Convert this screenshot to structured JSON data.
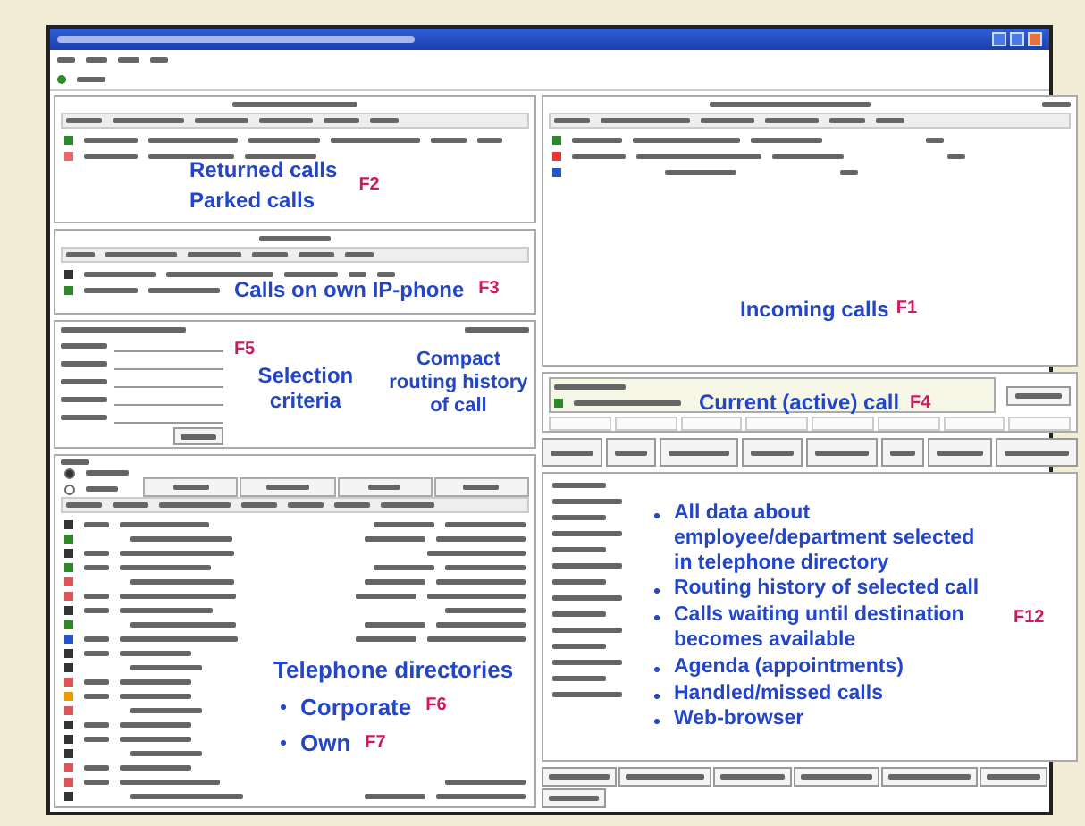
{
  "returned_panel": {
    "notes": [
      "Returned calls",
      "Parked calls"
    ],
    "key": "F2"
  },
  "incoming_panel": {
    "note": "Incoming calls",
    "key": "F1"
  },
  "own_phone_panel": {
    "note": "Calls on own IP-phone",
    "key": "F3"
  },
  "search_panel": {
    "key": "F5",
    "note": "Selection criteria",
    "routing_note": "Compact routing history of call"
  },
  "directory": {
    "options": [
      {
        "selected": true
      },
      {
        "selected": false
      }
    ],
    "note": "Telephone directories",
    "items": [
      {
        "label": "Corporate",
        "key": "F6"
      },
      {
        "label": "Own",
        "key": "F7"
      }
    ]
  },
  "current_call": {
    "note": "Current (active) call",
    "key": "F4"
  },
  "details": {
    "key": "F12",
    "notes": [
      "All data about employee/department selected in telephone directory",
      "Routing history of selected call",
      "Calls waiting until destination becomes available",
      "Agenda (appointments)",
      "Handled/missed calls",
      "Web-browser"
    ]
  }
}
